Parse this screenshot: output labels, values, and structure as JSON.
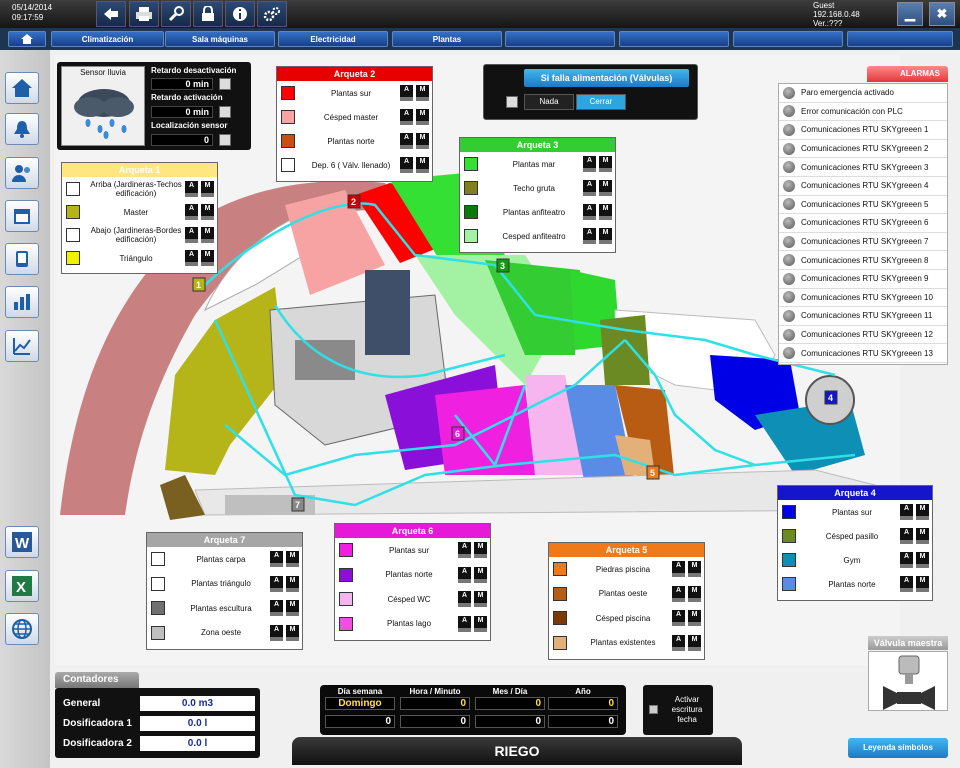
{
  "topbar": {
    "date": "05/14/2014",
    "time": "09:17:59",
    "user": "Guest",
    "ip": "192.168.0.48",
    "ver": "Ver.:???"
  },
  "icons": [
    "back-arrow-icon",
    "print-icon",
    "wrench-icon",
    "lock-icon",
    "info-icon",
    "gears-icon"
  ],
  "nav": [
    {
      "label": ""
    },
    {
      "label": "Climatización"
    },
    {
      "label": "Sala máquinas"
    },
    {
      "label": "Electricidad"
    },
    {
      "label": "Plantas"
    },
    {
      "label": ""
    },
    {
      "label": ""
    },
    {
      "label": ""
    },
    {
      "label": ""
    }
  ],
  "sensor": {
    "title": "Sensor lluvia",
    "retardo_desactivacion_label": "Retardo desactivación",
    "retardo_desactivacion": "0 min",
    "retardo_activacion_label": "Retardo activación",
    "retardo_activacion": "0 min",
    "localizacion_label": "Localización sensor",
    "localizacion": "0"
  },
  "power": {
    "title": "Si falla alimentación (Válvulas)",
    "opt1": "Nada",
    "opt2": "Cerrar"
  },
  "alarms": {
    "title": "ALARMAS",
    "items": [
      "Paro emergencia activado",
      "Error comunicación con PLC",
      "Comunicaciones RTU SKYgreeen 1",
      "Comunicaciones RTU SKYgreeen 2",
      "Comunicaciones RTU SKYgreeen 3",
      "Comunicaciones RTU SKYgreeen 4",
      "Comunicaciones RTU SKYgreeen 5",
      "Comunicaciones RTU SKYgreeen 6",
      "Comunicaciones RTU SKYgreeen 7",
      "Comunicaciones RTU SKYgreeen 8",
      "Comunicaciones RTU SKYgreeen 9",
      "Comunicaciones RTU SKYgreeen 10",
      "Comunicaciones RTU SKYgreeen 11",
      "Comunicaciones RTU SKYgreeen 12",
      "Comunicaciones RTU SKYgreeen 13"
    ]
  },
  "am": {
    "a": "A",
    "m": "M"
  },
  "arquetas": [
    {
      "title": "Arqueta 1",
      "head": "#ffe680",
      "rows": [
        {
          "label": "Arriba (Jardineras-Techos edificación)",
          "color": "#ffffff"
        },
        {
          "label": "Master",
          "color": "#b5b418"
        },
        {
          "label": "Abajo (Jardineras-Bordes edificación)",
          "color": "#ffffff"
        },
        {
          "label": "Triángulo",
          "color": "#f2f200"
        }
      ]
    },
    {
      "title": "Arqueta 2",
      "head": "#e60000",
      "rows": [
        {
          "label": "Plantas sur",
          "color": "#ff0000"
        },
        {
          "label": "Césped master",
          "color": "#f7a3a3"
        },
        {
          "label": "Plantas norte",
          "color": "#c94f10"
        },
        {
          "label": "Dep. 6 ( Válv. llenado)",
          "color": "#ffffff"
        }
      ]
    },
    {
      "title": "Arqueta 3",
      "head": "#33cc33",
      "rows": [
        {
          "label": "Plantas mar",
          "color": "#33e033"
        },
        {
          "label": "Techo gruta",
          "color": "#808020"
        },
        {
          "label": "Plantas anfiteatro",
          "color": "#0a7a0a"
        },
        {
          "label": "Cesped anfiteatro",
          "color": "#a3f2a3"
        }
      ]
    },
    {
      "title": "Arqueta 4",
      "head": "#1515cc",
      "rows": [
        {
          "label": "Plantas sur",
          "color": "#0000e6"
        },
        {
          "label": "Césped pasillo",
          "color": "#6b8a23"
        },
        {
          "label": "Gym",
          "color": "#0e8fb5"
        },
        {
          "label": "Plantas norte",
          "color": "#5a8ce6"
        }
      ]
    },
    {
      "title": "Arqueta 5",
      "head": "#f07a1a",
      "rows": [
        {
          "label": "Piedras piscina",
          "color": "#f07a1a"
        },
        {
          "label": "Plantas oeste",
          "color": "#b85c14"
        },
        {
          "label": "Césped piscina",
          "color": "#7a3a0a"
        },
        {
          "label": "Plantas existentes",
          "color": "#e3b07a"
        }
      ]
    },
    {
      "title": "Arqueta 6",
      "head": "#e619d9",
      "rows": [
        {
          "label": "Plantas sur",
          "color": "#f020e0"
        },
        {
          "label": "Plantas norte",
          "color": "#8a10d9"
        },
        {
          "label": "Césped WC",
          "color": "#f7b5f0"
        },
        {
          "label": "Plantas lago",
          "color": "#f050e0"
        }
      ]
    },
    {
      "title": "Arqueta 7",
      "head": "#a6a6a6",
      "rows": [
        {
          "label": "Plantas carpa",
          "color": "#ffffff"
        },
        {
          "label": "Plantas triángulo",
          "color": "#ffffff"
        },
        {
          "label": "Plantas escultura",
          "color": "#707070"
        },
        {
          "label": "Zona oeste",
          "color": "#bfbfbf"
        }
      ]
    }
  ],
  "markers": [
    "1",
    "2",
    "3",
    "4",
    "5",
    "6",
    "7"
  ],
  "contadores": {
    "title": "Contadores",
    "rows": [
      {
        "label": "General",
        "value": "0.0 m3"
      },
      {
        "label": "Dosificadora 1",
        "value": "0.0 l"
      },
      {
        "label": "Dosificadora 2",
        "value": "0.0 l"
      }
    ]
  },
  "clock": {
    "h1": "Día semana",
    "h2": "Hora / Minuto",
    "h3": "Mes / Día",
    "h4": "Año",
    "day": "Domingo",
    "hour": "0",
    "month": "0",
    "year": "0",
    "r2a": "0",
    "r2b": "0",
    "r2c": "0",
    "r2d": "0",
    "activar": "Activar escritura fecha"
  },
  "riego": "RIEGO",
  "valvula": "Válvula maestra",
  "leyenda": "Leyenda símbolos"
}
